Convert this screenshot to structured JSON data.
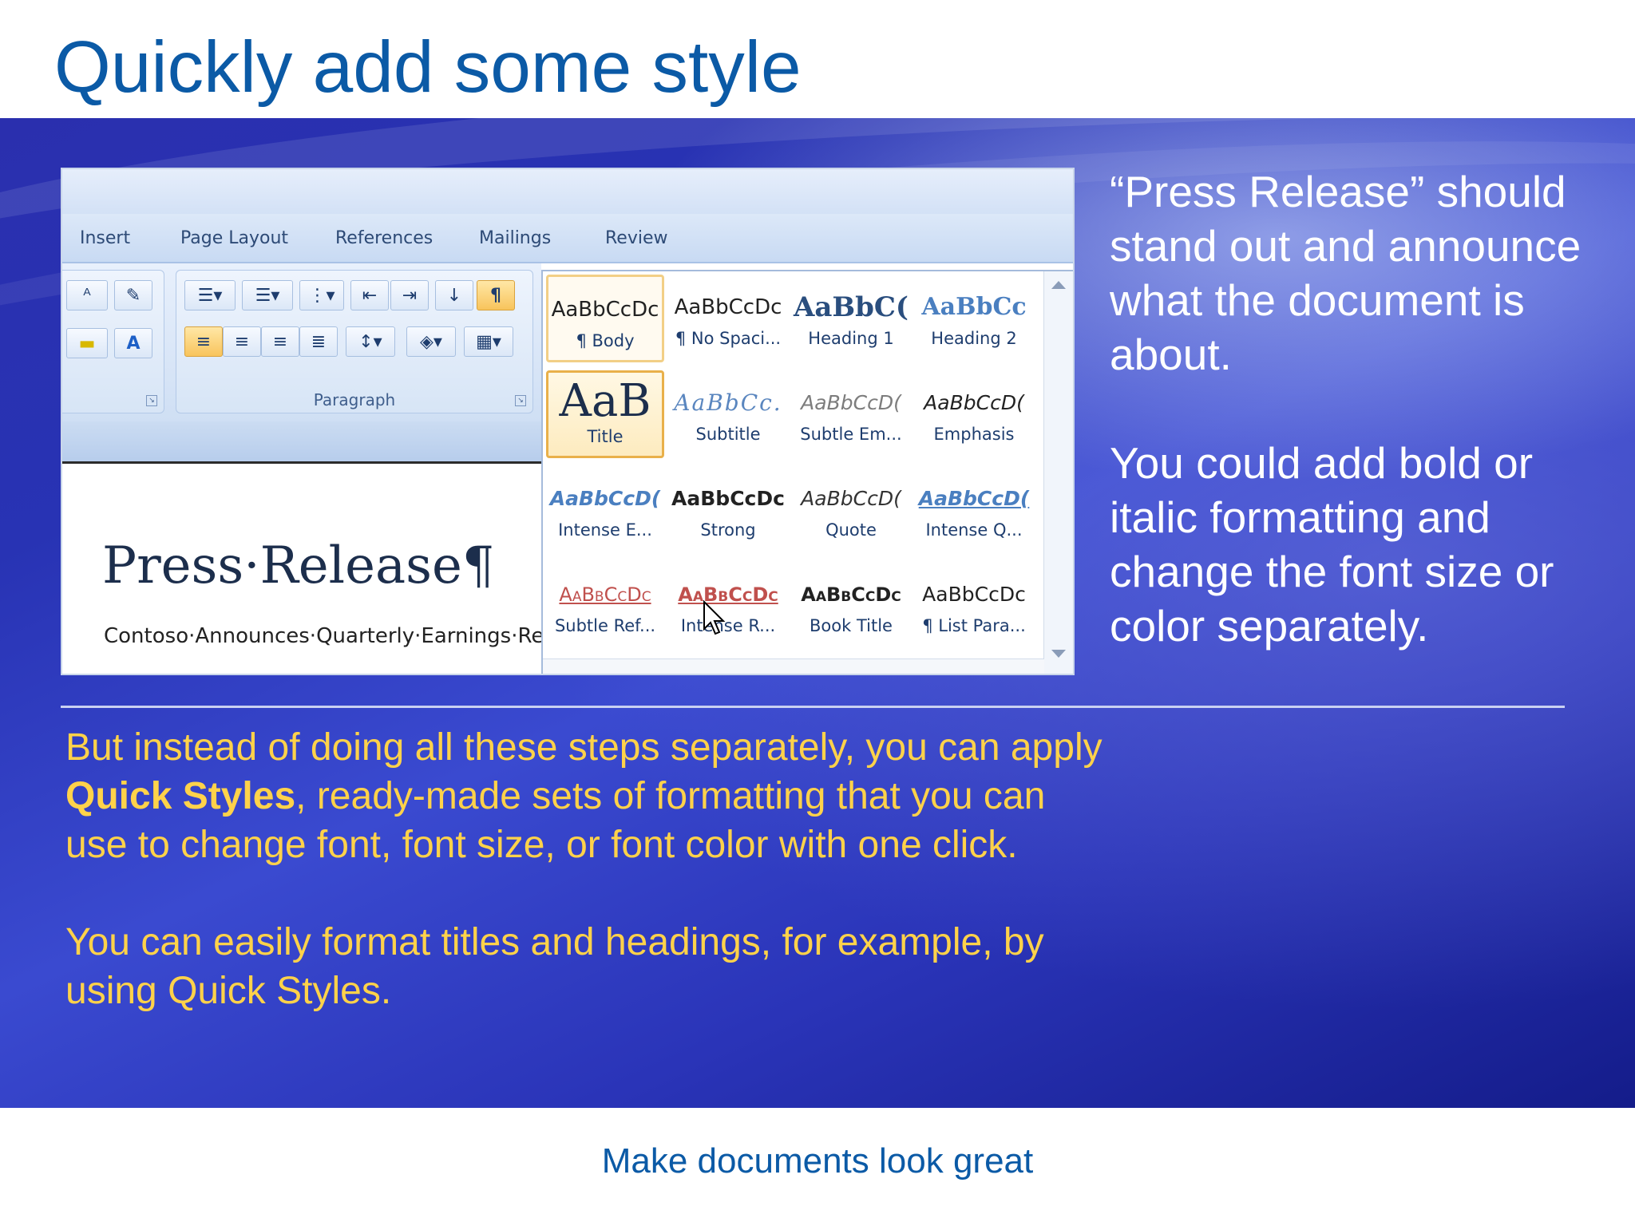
{
  "slide": {
    "title": "Quickly add some style",
    "footer": "Make documents look great"
  },
  "ribbon": {
    "tabs": [
      "Insert",
      "Page Layout",
      "References",
      "Mailings",
      "Review"
    ],
    "paragraph_group": "Paragraph",
    "pilcrow": "¶"
  },
  "document": {
    "title": "Press·Release¶",
    "subtitle": "Contoso·Announces·Quarterly·Earnings·Res"
  },
  "gallery": {
    "styles": [
      {
        "sample": "AaBbCcDc",
        "name": "¶ Body",
        "state": "hover"
      },
      {
        "sample": "AaBbCcDc",
        "name": "¶ No Spaci..."
      },
      {
        "sample": "AaBbC(",
        "name": "Heading 1"
      },
      {
        "sample": "AaBbCc",
        "name": "Heading 2"
      },
      {
        "sample": "AaB",
        "name": "Title",
        "state": "selected"
      },
      {
        "sample": "AaBbCc.",
        "name": "Subtitle"
      },
      {
        "sample": "AaBbCcD(",
        "name": "Subtle Em..."
      },
      {
        "sample": "AaBbCcD(",
        "name": "Emphasis"
      },
      {
        "sample": "AaBbCcD(",
        "name": "Intense E..."
      },
      {
        "sample": "AaBbCcDc",
        "name": "Strong"
      },
      {
        "sample": "AaBbCcD(",
        "name": "Quote"
      },
      {
        "sample": "AaBbCcD(",
        "name": "Intense Q..."
      },
      {
        "sample": "AaBbCcDc",
        "name": "Subtle Ref..."
      },
      {
        "sample": "AaBbCcDc",
        "name": "Intense R..."
      },
      {
        "sample": "AaBbCcDc",
        "name": "Book Title"
      },
      {
        "sample": "AaBbCcDc",
        "name": "¶ List Para..."
      }
    ]
  },
  "side_text": {
    "p1": "“Press Release” should stand out and announce what the document is about.",
    "p2": "You could add bold or italic formatting and change the font size or color separately."
  },
  "body_text": {
    "p1_before": "But instead of doing all these steps separately, you can apply ",
    "p1_bold": "Quick Styles",
    "p1_after": ", ready-made sets of formatting that you can use to change font, font size, or font color with one click.",
    "p2": "You can easily format titles and headings, for example, by using Quick Styles."
  },
  "colors": {
    "title_blue": "#0b5aa6",
    "band_blue": "#2a34b8",
    "body_yellow": "#ffd24a",
    "highlight_orange": "#e9b04a"
  }
}
